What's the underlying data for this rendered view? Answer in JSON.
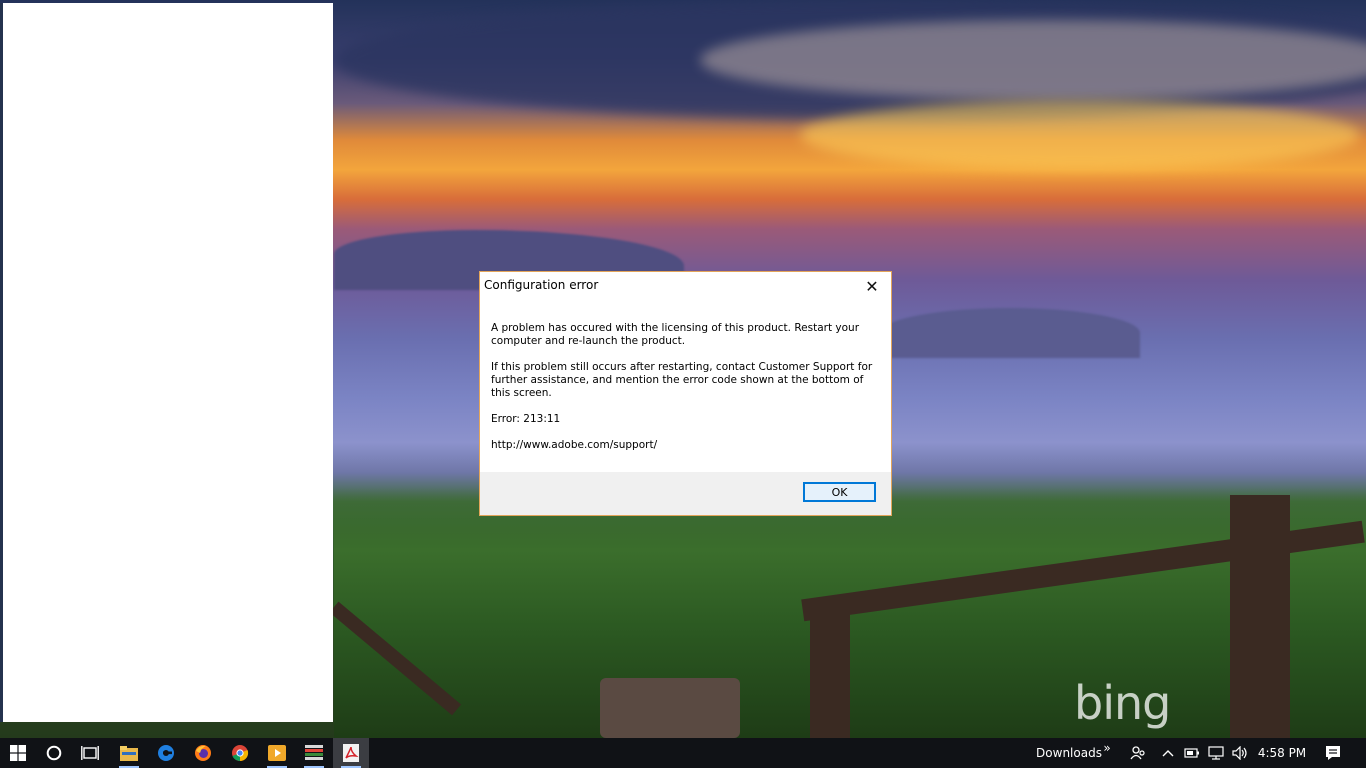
{
  "dialog": {
    "title": "Configuration error",
    "close_glyph": "✕",
    "paragraph1": "A problem has occured with the licensing of this product. Restart your computer and re-launch the product.",
    "paragraph2": "If this problem still occurs after restarting, contact Customer Support for further assistance, and mention the error code shown at the bottom of this screen.",
    "error_line": "Error: 213:11",
    "support_url": "http://www.adobe.com/support/",
    "ok_label": "OK"
  },
  "desktop": {
    "watermark": "bing"
  },
  "taskbar": {
    "apps": [
      {
        "icon": "windows-start-icon"
      },
      {
        "icon": "cortana-icon"
      },
      {
        "icon": "task-view-icon"
      },
      {
        "icon": "file-explorer-icon"
      },
      {
        "icon": "edge-icon"
      },
      {
        "icon": "firefox-icon"
      },
      {
        "icon": "chrome-icon"
      },
      {
        "icon": "media-player-icon"
      },
      {
        "icon": "app-icon"
      },
      {
        "icon": "acrobat-icon"
      }
    ],
    "downloads_label": "Downloads",
    "chevron": "»",
    "clock": "4:58 PM"
  },
  "colors": {
    "accent": "#0078d7",
    "dialog_border": "#e3a55a",
    "taskbar_bg": "#101216"
  }
}
